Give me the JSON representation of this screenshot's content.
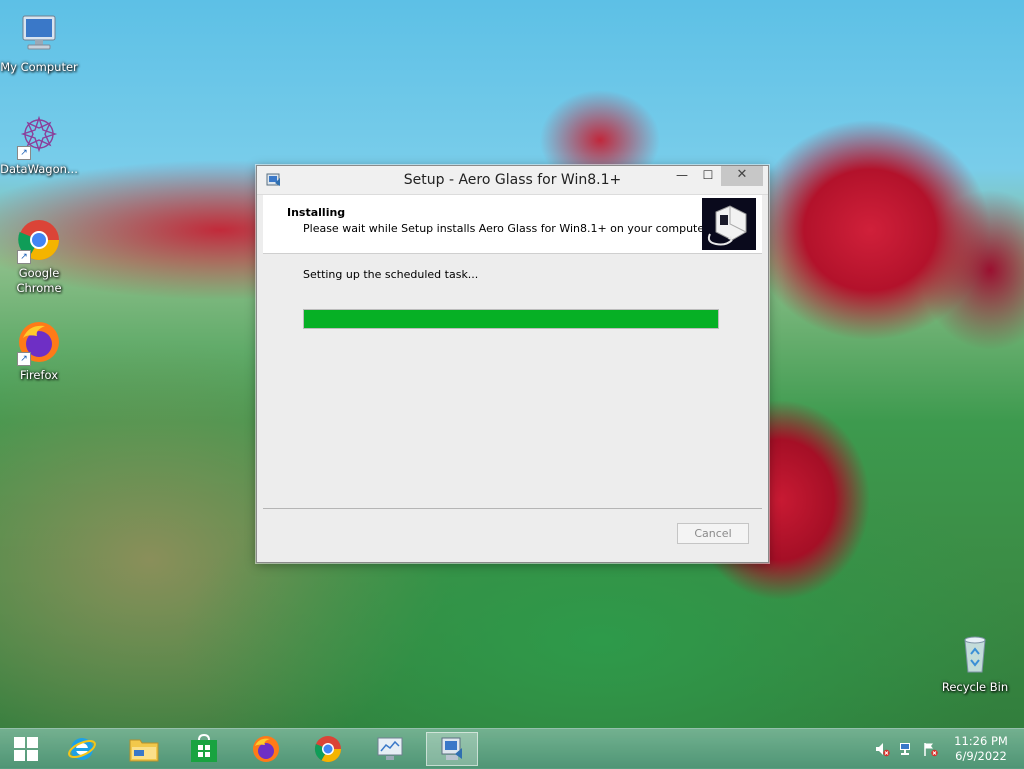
{
  "desktop": {
    "icons": [
      {
        "label": "My Computer",
        "icon": "computer-icon"
      },
      {
        "label": "DataWagon...",
        "icon": "datawagon-icon"
      },
      {
        "label": "Google Chrome",
        "icon": "chrome-icon"
      },
      {
        "label": "Firefox",
        "icon": "firefox-icon"
      },
      {
        "label": "Recycle Bin",
        "icon": "recycle-bin-icon"
      }
    ]
  },
  "window": {
    "title": "Setup - Aero Glass for Win8.1+",
    "heading": "Installing",
    "subheading": "Please wait while Setup installs Aero Glass for Win8.1+ on your computer.",
    "status": "Setting up the scheduled task...",
    "progress": 1.0,
    "cancel_label": "Cancel",
    "controls": {
      "minimize": "—",
      "maximize": "☐",
      "close": "✕"
    }
  },
  "taskbar": {
    "items": [
      "start-icon",
      "internet-explorer-icon",
      "file-explorer-icon",
      "store-icon",
      "firefox-icon",
      "chrome-icon",
      "monitor-app-icon",
      "setup-icon"
    ],
    "active_item": "setup-icon",
    "clock": {
      "time": "11:26 PM",
      "date": "6/9/2022"
    }
  },
  "colors": {
    "progress_fill": "#06b025",
    "taskbar": "#5a9e82"
  }
}
